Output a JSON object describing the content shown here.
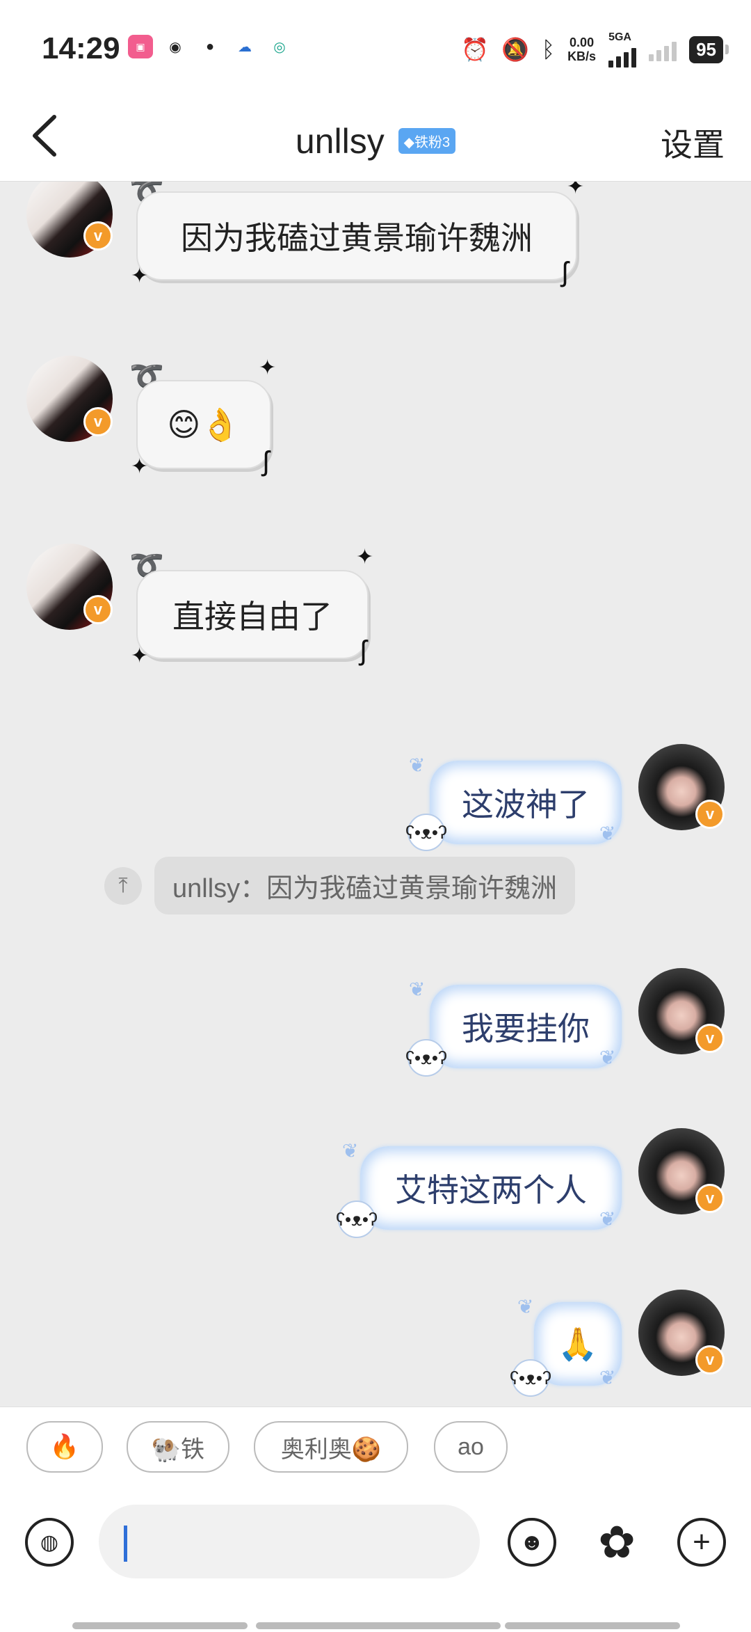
{
  "status_bar": {
    "time": "14:29",
    "net_speed_value": "0.00",
    "net_speed_unit": "KB/s",
    "network_type": "5GA",
    "battery": "95"
  },
  "nav": {
    "title": "unllsy",
    "fan_badge": "◆铁粉3",
    "settings": "设置"
  },
  "messages": [
    {
      "side": "left",
      "text": "因为我磕过黄景瑜许魏洲"
    },
    {
      "side": "left",
      "text": "😊👌"
    },
    {
      "side": "left",
      "text": "直接自由了"
    },
    {
      "side": "right",
      "text": "这波神了"
    },
    {
      "side": "right",
      "text": "我要挂你"
    },
    {
      "side": "right",
      "text": "艾特这两个人"
    },
    {
      "side": "right",
      "text": "🙏"
    }
  ],
  "quote": {
    "text": "unllsy：因为我磕过黄景瑜许魏洲"
  },
  "quick_replies": [
    "🔥",
    "🐏铁",
    "奥利奥🍪",
    "ao"
  ],
  "icons": {
    "voice": "voice-icon",
    "emoji": "emoji-icon",
    "sticker": "sticker-icon",
    "add": "add-icon"
  }
}
